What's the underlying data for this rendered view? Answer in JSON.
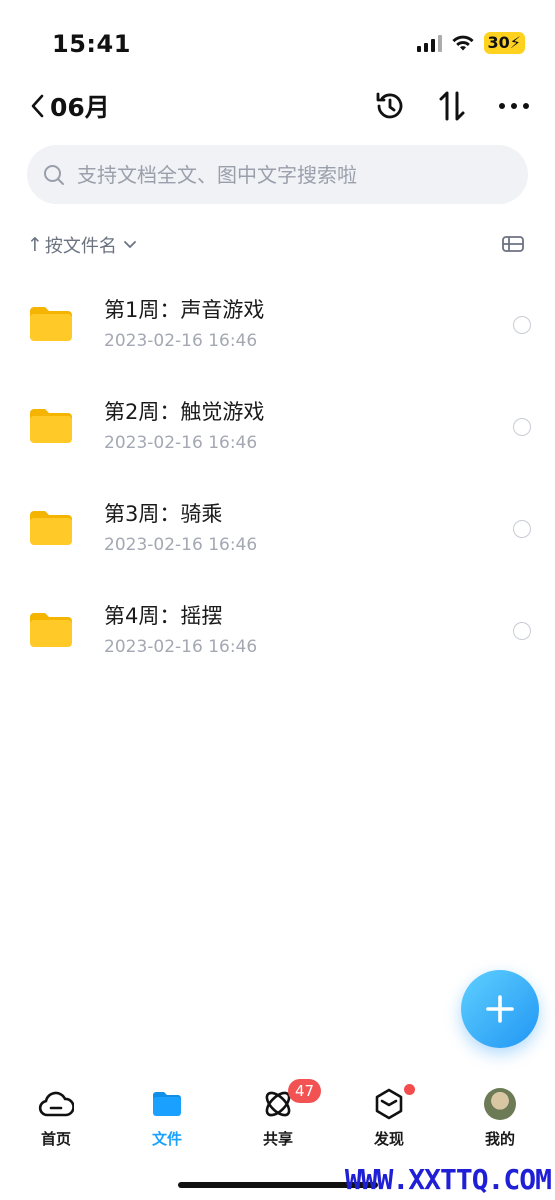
{
  "status": {
    "time": "15:41",
    "battery": "30"
  },
  "header": {
    "title": "06月"
  },
  "search": {
    "placeholder": "支持文档全文、图中文字搜索啦"
  },
  "sort": {
    "label": "按文件名"
  },
  "files": [
    {
      "name": "第1周：声音游戏",
      "date": "2023-02-16 16:46"
    },
    {
      "name": "第2周：触觉游戏",
      "date": "2023-02-16 16:46"
    },
    {
      "name": "第3周：骑乘",
      "date": "2023-02-16 16:46"
    },
    {
      "name": "第4周：摇摆",
      "date": "2023-02-16 16:46"
    }
  ],
  "tabs": [
    {
      "label": "首页",
      "icon": "cloud-icon"
    },
    {
      "label": "文件",
      "icon": "folder-icon",
      "active": true
    },
    {
      "label": "共享",
      "icon": "atom-icon",
      "badge": "47"
    },
    {
      "label": "发现",
      "icon": "cube-icon"
    },
    {
      "label": "我的",
      "icon": "avatar"
    }
  ],
  "watermark": "WWW.XXTTQ.COM",
  "colors": {
    "accent": "#1aa1ff",
    "folder": "#ffc928",
    "badge": "#f25252"
  }
}
